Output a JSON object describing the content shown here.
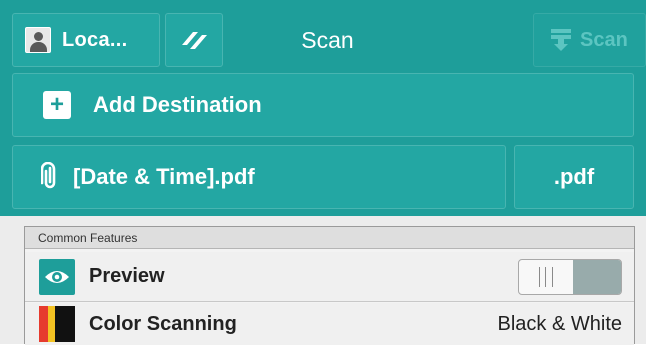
{
  "header": {
    "user_label": "Loca...",
    "title": "Scan",
    "scan_button_label": "Scan"
  },
  "destination": {
    "add_label": "Add Destination",
    "file_name": "[Date & Time].pdf",
    "file_type": ".pdf"
  },
  "features": {
    "section_title": "Common Features",
    "preview_label": "Preview",
    "preview_toggle_on": false,
    "color_label": "Color Scanning",
    "color_value": "Black & White"
  },
  "colors": {
    "teal": "#1e9e9a",
    "panel_bg": "#ececec"
  },
  "icons": [
    "user-icon",
    "tool-icon",
    "scan-icon",
    "plus-icon",
    "paperclip-icon",
    "eye-icon",
    "color-palette-icon"
  ]
}
